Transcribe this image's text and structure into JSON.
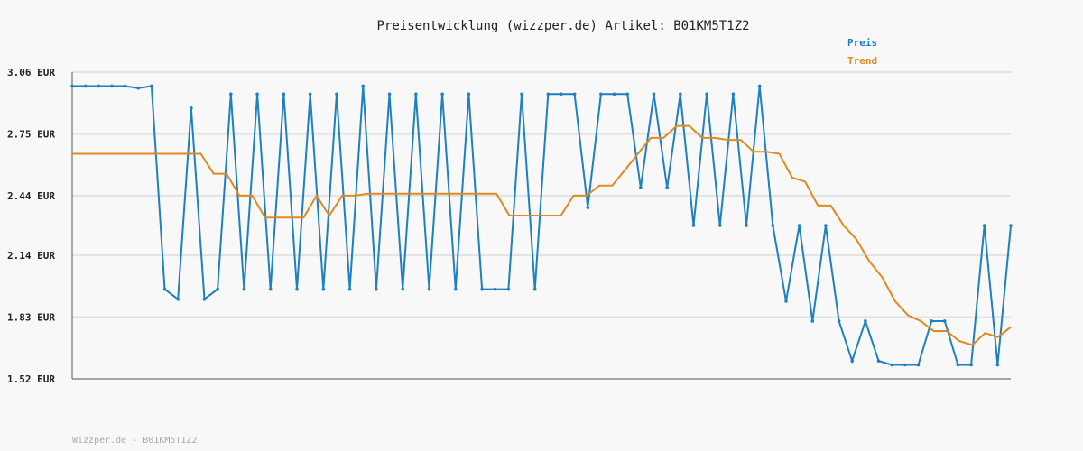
{
  "chart_data": {
    "type": "line",
    "title": "Preisentwicklung (wizzper.de) Artikel: B01KM5T1Z2",
    "footer": "Wizzper.de - B01KM5T1Z2",
    "ylim": [
      1.52,
      3.06
    ],
    "yticks": [
      "3.06 EUR",
      "2.75 EUR",
      "2.44 EUR",
      "2.14 EUR",
      "1.83 EUR",
      "1.52 EUR"
    ],
    "ytick_values": [
      3.06,
      2.75,
      2.44,
      2.14,
      1.83,
      1.52
    ],
    "grid": true,
    "legend_position": "top-right",
    "x": [
      0,
      1,
      2,
      3,
      4,
      5,
      6,
      7,
      8,
      9,
      10,
      11,
      12,
      13,
      14,
      15,
      16,
      17,
      18,
      19,
      20,
      21,
      22,
      23,
      24,
      25,
      26,
      27,
      28,
      29,
      30,
      31,
      32,
      33,
      34,
      35,
      36,
      37,
      38,
      39,
      40,
      41,
      42,
      43,
      44,
      45,
      46,
      47,
      48,
      49,
      50,
      51,
      52,
      53,
      54,
      55,
      56,
      57,
      58,
      59,
      60,
      61,
      62,
      63,
      64,
      65,
      66,
      67,
      68,
      69,
      70
    ],
    "series": [
      {
        "name": "Preis",
        "color": "#1f7fbf",
        "values": [
          2.99,
          2.99,
          2.99,
          2.99,
          2.99,
          2.98,
          2.99,
          1.97,
          1.92,
          2.88,
          1.92,
          1.97,
          2.95,
          1.97,
          2.95,
          1.97,
          2.95,
          1.97,
          2.95,
          1.97,
          2.95,
          1.97,
          2.99,
          1.97,
          2.95,
          1.97,
          2.95,
          1.97,
          2.95,
          1.97,
          2.95,
          1.97,
          1.97,
          1.97,
          2.95,
          1.97,
          2.95,
          2.95,
          2.95,
          2.38,
          2.95,
          2.95,
          2.95,
          2.48,
          2.95,
          2.48,
          2.95,
          2.29,
          2.95,
          2.29,
          2.95,
          2.29,
          2.99,
          2.29,
          1.91,
          2.29,
          1.81,
          2.29,
          1.81,
          1.61,
          1.81,
          1.61,
          1.59,
          1.59,
          1.59,
          1.81,
          1.81,
          1.59,
          1.59,
          2.29,
          1.59,
          2.29
        ]
      },
      {
        "name": "Trend",
        "color": "#e08a1e",
        "values": [
          2.65,
          2.65,
          2.65,
          2.65,
          2.65,
          2.65,
          2.65,
          2.65,
          2.65,
          2.65,
          2.65,
          2.55,
          2.55,
          2.44,
          2.44,
          2.33,
          2.33,
          2.33,
          2.33,
          2.44,
          2.34,
          2.44,
          2.44,
          2.45,
          2.45,
          2.45,
          2.45,
          2.45,
          2.45,
          2.45,
          2.45,
          2.45,
          2.45,
          2.45,
          2.34,
          2.34,
          2.34,
          2.34,
          2.34,
          2.44,
          2.44,
          2.49,
          2.49,
          2.57,
          2.65,
          2.73,
          2.73,
          2.79,
          2.79,
          2.73,
          2.73,
          2.72,
          2.72,
          2.66,
          2.66,
          2.65,
          2.53,
          2.51,
          2.39,
          2.39,
          2.29,
          2.22,
          2.11,
          2.03,
          1.91,
          1.84,
          1.81,
          1.76,
          1.76,
          1.71,
          1.69,
          1.75,
          1.73,
          1.78
        ]
      }
    ]
  }
}
